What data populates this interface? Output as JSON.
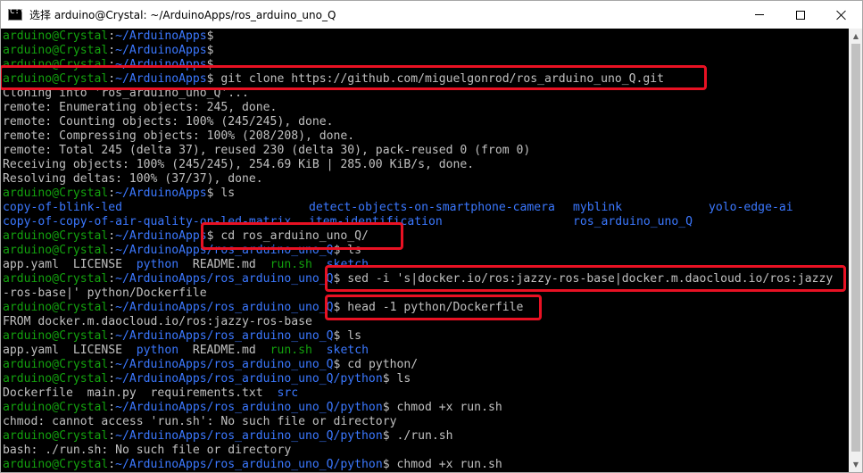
{
  "window": {
    "title": "选择 arduino@Crystal: ~/ArduinoApps/ros_arduino_uno_Q",
    "controls": {
      "minimize": "minimize",
      "maximize": "maximize",
      "close": "close"
    }
  },
  "colors": {
    "prompt_user": "#13a10e",
    "path": "#3b78ff",
    "text": "#c0c0c0",
    "highlight": "#e81123",
    "background": "#000000"
  },
  "prompt": {
    "user": "arduino@Crystal",
    "colon": ":"
  },
  "lines": [
    {
      "type": "prompt",
      "path": "~/ArduinoApps",
      "cmd": ""
    },
    {
      "type": "prompt",
      "path": "~/ArduinoApps",
      "cmd": ""
    },
    {
      "type": "prompt",
      "path": "~/ArduinoApps",
      "cmd": ""
    },
    {
      "type": "prompt",
      "path": "~/ArduinoApps",
      "cmd": " git clone https://github.com/miguelgonrod/ros_arduino_uno_Q.git"
    },
    {
      "type": "out",
      "text": "Cloning into 'ros_arduino_uno_Q'..."
    },
    {
      "type": "out",
      "text": "remote: Enumerating objects: 245, done."
    },
    {
      "type": "out",
      "text": "remote: Counting objects: 100% (245/245), done."
    },
    {
      "type": "out",
      "text": "remote: Compressing objects: 100% (208/208), done."
    },
    {
      "type": "out",
      "text": "remote: Total 245 (delta 37), reused 230 (delta 30), pack-reused 0 (from 0)"
    },
    {
      "type": "out",
      "text": "Receiving objects: 100% (245/245), 254.69 KiB | 285.00 KiB/s, done."
    },
    {
      "type": "out",
      "text": "Resolving deltas: 100% (37/37), done."
    },
    {
      "type": "prompt",
      "path": "~/ArduinoApps",
      "cmd": " ls"
    },
    {
      "type": "ls1"
    },
    {
      "type": "ls2"
    },
    {
      "type": "prompt",
      "path": "~/ArduinoApps",
      "cmd": " cd ros_arduino_uno_Q/"
    },
    {
      "type": "prompt",
      "path": "~/ArduinoApps/ros_arduino_uno_Q",
      "cmd": " ls"
    },
    {
      "type": "mixed",
      "parts": [
        {
          "text": "app.yaml  LICENSE  ",
          "c": "w"
        },
        {
          "text": "python",
          "c": "b"
        },
        {
          "text": "  README.md  ",
          "c": "w"
        },
        {
          "text": "run.sh",
          "c": "g"
        },
        {
          "text": "  ",
          "c": "w"
        },
        {
          "text": "sketch",
          "c": "b"
        }
      ]
    },
    {
      "type": "prompt",
      "path": "~/ArduinoApps/ros_arduino_uno_Q",
      "cmd": " sed -i 's|docker.io/ros:jazzy-ros-base|docker.m.daocloud.io/ros:jazzy"
    },
    {
      "type": "out",
      "text": "-ros-base|' python/Dockerfile"
    },
    {
      "type": "prompt",
      "path": "~/ArduinoApps/ros_arduino_uno_Q",
      "cmd": " head -1 python/Dockerfile"
    },
    {
      "type": "out",
      "text": "FROM docker.m.daocloud.io/ros:jazzy-ros-base"
    },
    {
      "type": "prompt",
      "path": "~/ArduinoApps/ros_arduino_uno_Q",
      "cmd": " ls"
    },
    {
      "type": "mixed",
      "parts": [
        {
          "text": "app.yaml  LICENSE  ",
          "c": "w"
        },
        {
          "text": "python",
          "c": "b"
        },
        {
          "text": "  README.md  ",
          "c": "w"
        },
        {
          "text": "run.sh",
          "c": "g"
        },
        {
          "text": "  ",
          "c": "w"
        },
        {
          "text": "sketch",
          "c": "b"
        }
      ]
    },
    {
      "type": "prompt",
      "path": "~/ArduinoApps/ros_arduino_uno_Q",
      "cmd": " cd python/"
    },
    {
      "type": "prompt",
      "path": "~/ArduinoApps/ros_arduino_uno_Q/python",
      "cmd": " ls"
    },
    {
      "type": "mixed",
      "parts": [
        {
          "text": "Dockerfile  main.py  requirements.txt  ",
          "c": "w"
        },
        {
          "text": "src",
          "c": "b"
        }
      ]
    },
    {
      "type": "prompt",
      "path": "~/ArduinoApps/ros_arduino_uno_Q/python",
      "cmd": " chmod +x run.sh"
    },
    {
      "type": "out",
      "text": "chmod: cannot access 'run.sh': No such file or directory"
    },
    {
      "type": "prompt",
      "path": "~/ArduinoApps/ros_arduino_uno_Q/python",
      "cmd": " ./run.sh"
    },
    {
      "type": "out",
      "text": "bash: ./run.sh: No such file or directory"
    },
    {
      "type": "prompt",
      "path": "~/ArduinoApps/ros_arduino_uno_Q/python",
      "cmd": " chmod +x run.sh"
    }
  ],
  "ls_listing": {
    "row1": [
      "copy-of-blink-led",
      "detect-objects-on-smartphone-camera",
      "myblink",
      "yolo-edge-ai"
    ],
    "row2": [
      "copy-of-copy-of-air-quality-on-led-matrix",
      "item-identification",
      "ros_arduino_uno_Q"
    ]
  }
}
